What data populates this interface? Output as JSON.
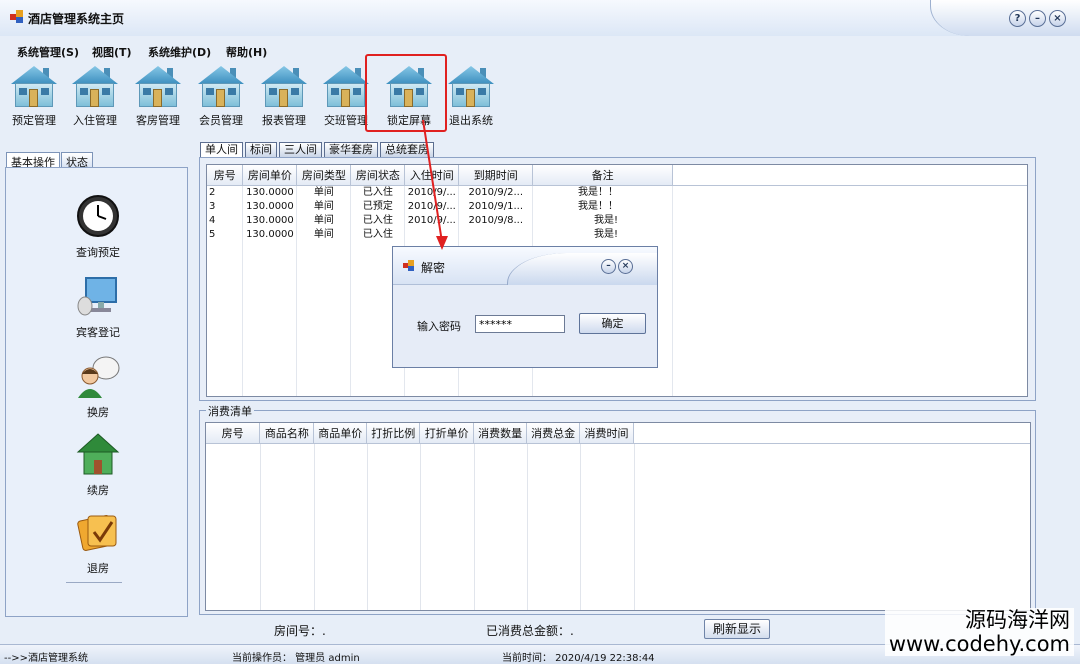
{
  "window": {
    "title": "酒店管理系统主页",
    "buttons": [
      "?",
      "–",
      "×"
    ]
  },
  "menu": [
    "系统管理(S)",
    "视图(T)",
    "系统维护(D)",
    "帮助(H)"
  ],
  "toolbar": [
    "预定管理",
    "入住管理",
    "客房管理",
    "会员管理",
    "报表管理",
    "交班管理",
    "锁定屏幕",
    "退出系统"
  ],
  "left_tabs": [
    "基本操作",
    "状态"
  ],
  "left_items": [
    "查询预定",
    "宾客登记",
    "换房",
    "续房",
    "退房"
  ],
  "room_tabs": [
    "单人间",
    "标间",
    "三人间",
    "豪华套房",
    "总统套房"
  ],
  "room_grid": {
    "headers": [
      "房号",
      "房间单价",
      "房间类型",
      "房间状态",
      "入住时间",
      "到期时间",
      "备注"
    ],
    "rows": [
      [
        "2",
        "130.0000",
        "单间",
        "已入住",
        "2010/9/...",
        "2010/9/2...",
        "我是！！"
      ],
      [
        "3",
        "130.0000",
        "单间",
        "已预定",
        "2010/9/...",
        "2010/9/1...",
        "我是！！"
      ],
      [
        "4",
        "130.0000",
        "单间",
        "已入住",
        "2010/9/...",
        "2010/9/8...",
        "我是!"
      ],
      [
        "5",
        "130.0000",
        "单间",
        "已入住",
        "",
        "",
        "我是!"
      ]
    ]
  },
  "consumption": {
    "label": "消费清单",
    "headers": [
      "房号",
      "商品名称",
      "商品单价",
      "打折比例",
      "打折单价",
      "消费数量",
      "消费总金",
      "消费时间"
    ]
  },
  "bottom": {
    "room_no": "房间号：.",
    "total": "已消费总金额：.",
    "refresh": "刷新显示"
  },
  "status": {
    "left": "-->>酒店管理系统",
    "operator": "当前操作员：   管理员  admin",
    "time": "当前时间：   2020/4/19 22:38:44"
  },
  "dialog": {
    "title": "解密",
    "label": "输入密码",
    "value": "******",
    "ok": "确定",
    "buttons": [
      "–",
      "×"
    ]
  },
  "watermark": {
    "line1": "源码海洋网",
    "line2": "www.codehy.com"
  },
  "colors": {
    "accent_red": "#e02020",
    "frame_blue": "#8ea3c6"
  }
}
